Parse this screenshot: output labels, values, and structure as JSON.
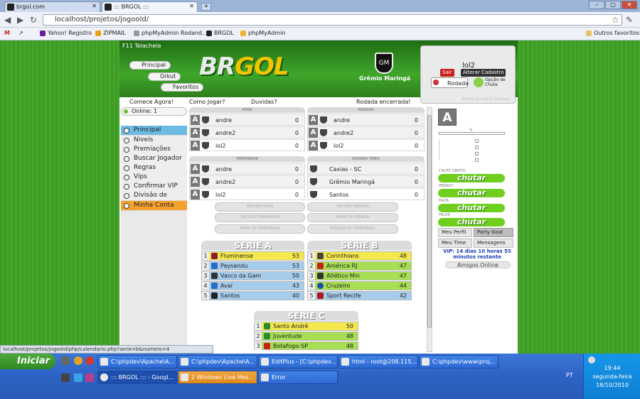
{
  "browser": {
    "tabs": [
      {
        "label": "brgol.com"
      },
      {
        "label": "::: BRGOL :::"
      }
    ],
    "url": "localhost/projetos/jogoold/",
    "bookmarks": [
      "Yahoo! Registro",
      "ZIPMAIL",
      "phpMyAdmin Rodand...",
      "BRGOL",
      "phpMyAdmin"
    ],
    "other_bookmarks": "Outros favoritos",
    "status_text": "localhost/projetos/jogoold/php/calendario.php?serie=b&numero=4"
  },
  "site": {
    "header_user": "F11 Telacheia",
    "nav": [
      "Principal",
      "Orkut",
      "Favoritos"
    ],
    "logo_a": "BR",
    "logo_b": "GOL",
    "club": "Grêmio Maringá",
    "user": {
      "name": "lol2",
      "sair": "Sair",
      "alterar": "Alterar Cadastro",
      "rodada": "Rodada",
      "opcao_chute": "Opção de Chute",
      "by": "BRGOL by José & Henrique"
    },
    "top_links": {
      "comece": "Comece Agora!",
      "como": "Como Jogar?",
      "duvidas": "Duvidas?",
      "rodada": "Rodada encerrada!"
    },
    "online": "Online: 1",
    "menu": [
      "Principal",
      "Niveis",
      "Premiações",
      "Buscar Jogador",
      "Regras",
      "Vips",
      "Confirmar VIP",
      "Divisão de Acesso",
      "Minha Conta"
    ]
  },
  "hora": {
    "title": "HORA",
    "rows": [
      {
        "name": "andre",
        "score": "0"
      },
      {
        "name": "andre2",
        "score": "0"
      },
      {
        "name": "lol2",
        "score": "0"
      }
    ]
  },
  "rodada": {
    "title": "RODADA",
    "rows": [
      {
        "name": "andre",
        "score": "0"
      },
      {
        "name": "andre2",
        "score": "0"
      },
      {
        "name": "lol2",
        "score": "0"
      }
    ]
  },
  "temporada": {
    "title": "TEMPORADA",
    "rows": [
      {
        "name": "andre",
        "score": "0"
      },
      {
        "name": "andre2",
        "score": "0"
      },
      {
        "name": "lol2",
        "score": "0"
      }
    ]
  },
  "rodada_times": {
    "title": "RODADA TIMES",
    "rows": [
      {
        "name": "Caxias - SC",
        "score": "0"
      },
      {
        "name": "Grêmio Maringá",
        "score": "0"
      },
      {
        "name": "Santos",
        "score": "0"
      }
    ]
  },
  "grey_buttons": [
    "RECORD HORA",
    "RECORD RODADA",
    "RECORD TEMPORADA",
    "HORA DA RODADA",
    "HORA DA TEMPORADA",
    "RODADA DA TEMPORADA"
  ],
  "serie_a": {
    "title": "SERIE A",
    "rows": [
      {
        "pos": "1",
        "team": "Fluminense",
        "pts": "53",
        "color": "yel"
      },
      {
        "pos": "2",
        "team": "Paysandu",
        "pts": "53",
        "color": "blu"
      },
      {
        "pos": "3",
        "team": "Vasco da Gam",
        "pts": "50",
        "color": "blu"
      },
      {
        "pos": "4",
        "team": "Avaí",
        "pts": "43",
        "color": "blu"
      },
      {
        "pos": "5",
        "team": "Santos",
        "pts": "40",
        "color": "blu"
      }
    ]
  },
  "serie_b": {
    "title": "SERIE B",
    "rows": [
      {
        "pos": "1",
        "team": "Corinthians",
        "pts": "48",
        "color": "yel"
      },
      {
        "pos": "2",
        "team": "América RJ",
        "pts": "47",
        "color": "grn"
      },
      {
        "pos": "3",
        "team": "Atlético Min",
        "pts": "47",
        "color": "grn"
      },
      {
        "pos": "4",
        "team": "Cruzeiro",
        "pts": "44",
        "color": "grn"
      },
      {
        "pos": "5",
        "team": "Sport Recife",
        "pts": "42",
        "color": "blu"
      }
    ]
  },
  "serie_c": {
    "title": "SERIE C",
    "rows": [
      {
        "pos": "1",
        "team": "Santo André",
        "pts": "50",
        "color": "yel"
      },
      {
        "pos": "2",
        "team": "Juventude",
        "pts": "48",
        "color": "grn"
      },
      {
        "pos": "3",
        "team": "Botafogo-SP",
        "pts": "48",
        "color": "grn"
      }
    ]
  },
  "right": {
    "chute_labels": [
      "CHUTE DIRETO",
      "PENALTI",
      "FALTA",
      "TALHA"
    ],
    "chutar": "chutar",
    "buttons": [
      "Meu Perfil",
      "Party Goal",
      "Meu Time",
      "Mensagens"
    ],
    "vip": "VIP: 14 dias 10 horas 55 minutos restante",
    "amigos": "Amigos Online"
  },
  "taskbar": {
    "start": "Iniciar",
    "tasks_top": [
      "C:\\phpdev\\Apache\\A...",
      "C:\\phpdev\\Apache\\A...",
      "EditPlus - [C:\\phpdev...",
      "html - root@208.115...",
      "C:\\phpdev\\www\\proj..."
    ],
    "tasks_bottom": [
      "::: BRGOL ::: - Googl...",
      "2 Windows Live Mes...",
      "Error"
    ],
    "lang": "PT",
    "time": "19:44",
    "day": "segunda-feira",
    "date": "18/10/2010"
  }
}
